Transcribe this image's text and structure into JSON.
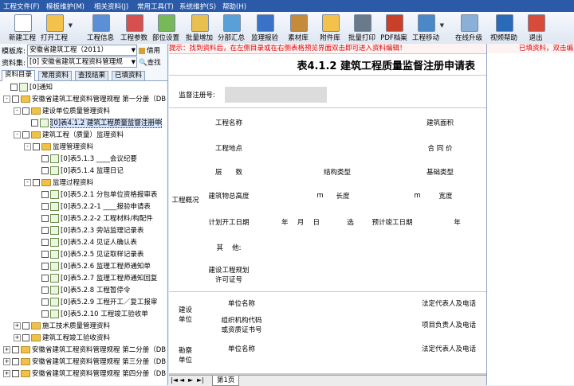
{
  "menu": [
    "工程文件(F)",
    "模板维护(M)",
    "相关资料(J)",
    "常用工具(T)",
    "系统维护(S)",
    "帮助(H)"
  ],
  "toolbar": [
    {
      "label": "新建工程",
      "icon": "new-project-icon",
      "color": "#ffffff",
      "dd": false
    },
    {
      "label": "打开工程",
      "icon": "open-folder-icon",
      "color": "#f2c24a",
      "dd": true
    },
    {
      "label": "工程信息",
      "icon": "project-info-icon",
      "color": "#5b8fd6",
      "dd": false
    },
    {
      "label": "工程参数",
      "icon": "project-params-icon",
      "color": "#d65050",
      "dd": false
    },
    {
      "label": "部位设置",
      "icon": "part-settings-icon",
      "color": "#78b858",
      "dd": false
    },
    {
      "label": "批量增加",
      "icon": "batch-add-icon",
      "color": "#e8c050",
      "dd": false
    },
    {
      "label": "分部汇总",
      "icon": "subtotal-icon",
      "color": "#5aa0d8",
      "dd": false
    },
    {
      "label": "监理报验",
      "icon": "inspection-icon",
      "color": "#3a72c8",
      "dd": false
    },
    {
      "label": "素材库",
      "icon": "material-library-icon",
      "color": "#c58a3a",
      "dd": false
    },
    {
      "label": "附件库",
      "icon": "attachment-library-icon",
      "color": "#f2c24a",
      "dd": false
    },
    {
      "label": "批量打印",
      "icon": "batch-print-icon",
      "color": "#6a7a8a",
      "dd": false
    },
    {
      "label": "PDF档案",
      "icon": "pdf-archive-icon",
      "color": "#c8402a",
      "dd": false
    },
    {
      "label": "工程移动",
      "icon": "project-move-icon",
      "color": "#4a88c8",
      "dd": true
    },
    {
      "label": "在线升级",
      "icon": "online-upgrade-icon",
      "color": "#8ab0d8",
      "dd": false
    },
    {
      "label": "视频帮助",
      "icon": "video-help-icon",
      "color": "#2a6ab8",
      "dd": false
    },
    {
      "label": "退出",
      "icon": "exit-icon",
      "color": "#d84a3a",
      "dd": false
    }
  ],
  "left": {
    "template_label": "模板库:",
    "template_value": "安徽省建筑工程（2011）",
    "borrow_label": "借用",
    "set_label": "资料集:",
    "set_value": "[0] 安徽省建筑工程资料管理规",
    "find_label": "查找",
    "tabs": [
      "资料目录",
      "常用资料",
      "查找结果",
      "已填资料"
    ],
    "tree": [
      {
        "level": 0,
        "kind": "doc",
        "text": "[0]通知",
        "exp": ""
      },
      {
        "level": 0,
        "kind": "fold",
        "text": "安徽省建筑工程资料管理规程 第一分册（DB",
        "exp": "-"
      },
      {
        "level": 1,
        "kind": "fold",
        "text": "建设单位质量管理资料",
        "exp": "-"
      },
      {
        "level": 2,
        "kind": "doc",
        "text": "[0]表4.1.2 建筑工程质量监督注册申",
        "exp": "",
        "sel": true
      },
      {
        "level": 1,
        "kind": "fold",
        "text": "建筑工程（质量）监理资料",
        "exp": "-"
      },
      {
        "level": 2,
        "kind": "fold",
        "text": "监理管理资料",
        "exp": "-"
      },
      {
        "level": 3,
        "kind": "doc",
        "text": "[0]表5.1.3 ____会议纪要",
        "exp": ""
      },
      {
        "level": 3,
        "kind": "doc",
        "text": "[0]表5.1.4 监理日记",
        "exp": ""
      },
      {
        "level": 2,
        "kind": "fold",
        "text": "监理过程资料",
        "exp": "-"
      },
      {
        "level": 3,
        "kind": "doc",
        "text": "[0]表5.2.1 分包单位资格报审表",
        "exp": ""
      },
      {
        "level": 3,
        "kind": "doc",
        "text": "[0]表5.2.2-1 ____报验申请表",
        "exp": ""
      },
      {
        "level": 3,
        "kind": "doc",
        "text": "[0]表5.2.2-2 工程材料/构配件",
        "exp": ""
      },
      {
        "level": 3,
        "kind": "doc",
        "text": "[0]表5.2.3 旁站监理记录表",
        "exp": ""
      },
      {
        "level": 3,
        "kind": "doc",
        "text": "[0]表5.2.4 见证人确认表",
        "exp": ""
      },
      {
        "level": 3,
        "kind": "doc",
        "text": "[0]表5.2.5 见证取样记录表",
        "exp": ""
      },
      {
        "level": 3,
        "kind": "doc",
        "text": "[0]表5.2.6 监理工程师通知单",
        "exp": ""
      },
      {
        "level": 3,
        "kind": "doc",
        "text": "[0]表5.2.7 监理工程师通知回复",
        "exp": ""
      },
      {
        "level": 3,
        "kind": "doc",
        "text": "[0]表5.2.8 工程暂停令",
        "exp": ""
      },
      {
        "level": 3,
        "kind": "doc",
        "text": "[0]表5.2.9 工程开工／复工报审",
        "exp": ""
      },
      {
        "level": 3,
        "kind": "doc",
        "text": "[0]表5.2.10 工程竣工验收单",
        "exp": ""
      },
      {
        "level": 1,
        "kind": "fold",
        "text": "施工技术质量管理资料",
        "exp": "+"
      },
      {
        "level": 1,
        "kind": "fold",
        "text": "建筑工程竣工验收资料",
        "exp": "+"
      },
      {
        "level": 0,
        "kind": "fold",
        "text": "安徽省建筑工程资料管理规程 第二分册（DB",
        "exp": "+"
      },
      {
        "level": 0,
        "kind": "fold",
        "text": "安徽省建筑工程资料管理规程 第三分册（DB",
        "exp": "+"
      },
      {
        "level": 0,
        "kind": "fold",
        "text": "安徽省建筑工程资料管理规程 第四分册（DB",
        "exp": "+"
      }
    ]
  },
  "hint": "提示：找到资料后，在左侧目录或在右侧表格预览界面双击即可进入资料编辑！",
  "right_hint": "已填资料，双击编",
  "form": {
    "title": "表4.1.2 建筑工程质量监督注册申请表",
    "reg_no_label": "监督注册号:",
    "overview": "工程概况",
    "project_name": "工程名称",
    "building_area": "建筑面积",
    "project_site": "工程地点",
    "contract_price": "合 同 价",
    "floors": "层　　数",
    "structure_type": "结构类型",
    "foundation_type": "基础类型",
    "total_height": "建筑物总高度",
    "unit_m": "m",
    "length": "长度",
    "width": "宽度",
    "plan_start": "计划开工日期",
    "date_mask": "年　 月　 日",
    "date_pick": "选",
    "plan_finish": "预计竣工日期",
    "year": "年",
    "other": "其　 他:",
    "permit": "建设工程规划\n许可证号",
    "builder": "建设\n单位",
    "unit_name": "单位名称",
    "legal_rep": "法定代表人及电话",
    "org_code": "组织机构代码\n或资质证书号",
    "pm": "项目负责人及电话",
    "survey": "勘察\n单位",
    "unit_name2": "单位名称",
    "legal_rep2": "法定代表人及电话"
  },
  "footer": {
    "nav": [
      "|◄",
      "◄",
      "►",
      "►|"
    ],
    "sheet": "第1页"
  }
}
